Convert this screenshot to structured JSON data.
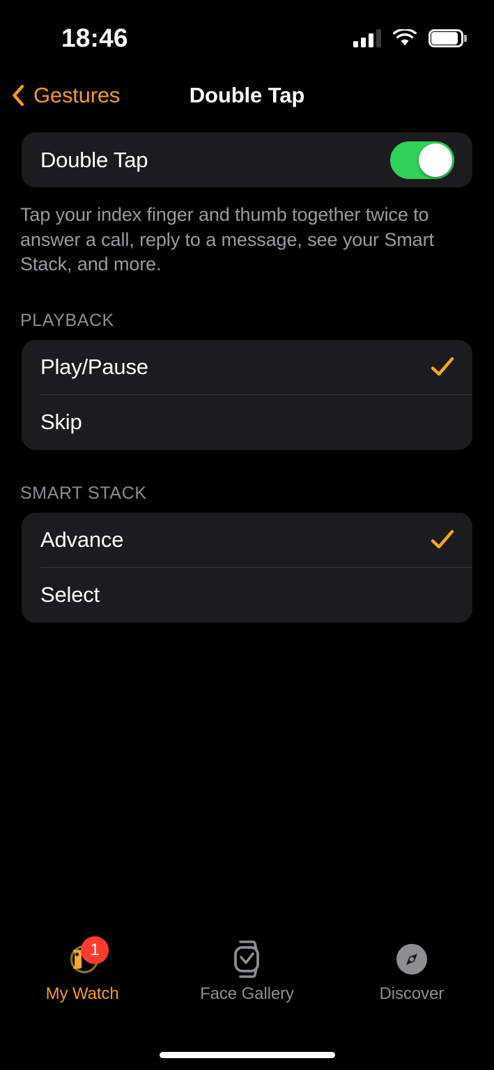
{
  "status_bar": {
    "time": "18:46",
    "signal_icon": "cellular-signal-icon",
    "wifi_icon": "wifi-icon",
    "battery_icon": "battery-full-icon"
  },
  "nav": {
    "back_icon": "chevron-left-icon",
    "back_label": "Gestures",
    "title": "Double Tap"
  },
  "main": {
    "master_toggle": {
      "label": "Double Tap",
      "state": "on",
      "on_color": "#30d158"
    },
    "footnote": "Tap your index finger and thumb together twice to answer a call, reply to a message, see your Smart Stack, and more.",
    "sections": [
      {
        "header": "PLAYBACK",
        "options": [
          {
            "label": "Play/Pause",
            "selected": true
          },
          {
            "label": "Skip",
            "selected": false
          }
        ]
      },
      {
        "header": "SMART STACK",
        "options": [
          {
            "label": "Advance",
            "selected": true
          },
          {
            "label": "Select",
            "selected": false
          }
        ]
      }
    ]
  },
  "tab_bar": {
    "accent_color": "#f09a2c",
    "inactive_color": "#8d8d92",
    "badge_color": "#ff3b30",
    "tabs": [
      {
        "label": "My Watch",
        "icon": "watch-side-icon",
        "active": true,
        "badge": "1"
      },
      {
        "label": "Face Gallery",
        "icon": "watch-face-check-icon",
        "active": false,
        "badge": ""
      },
      {
        "label": "Discover",
        "icon": "compass-icon",
        "active": false,
        "badge": ""
      }
    ]
  }
}
